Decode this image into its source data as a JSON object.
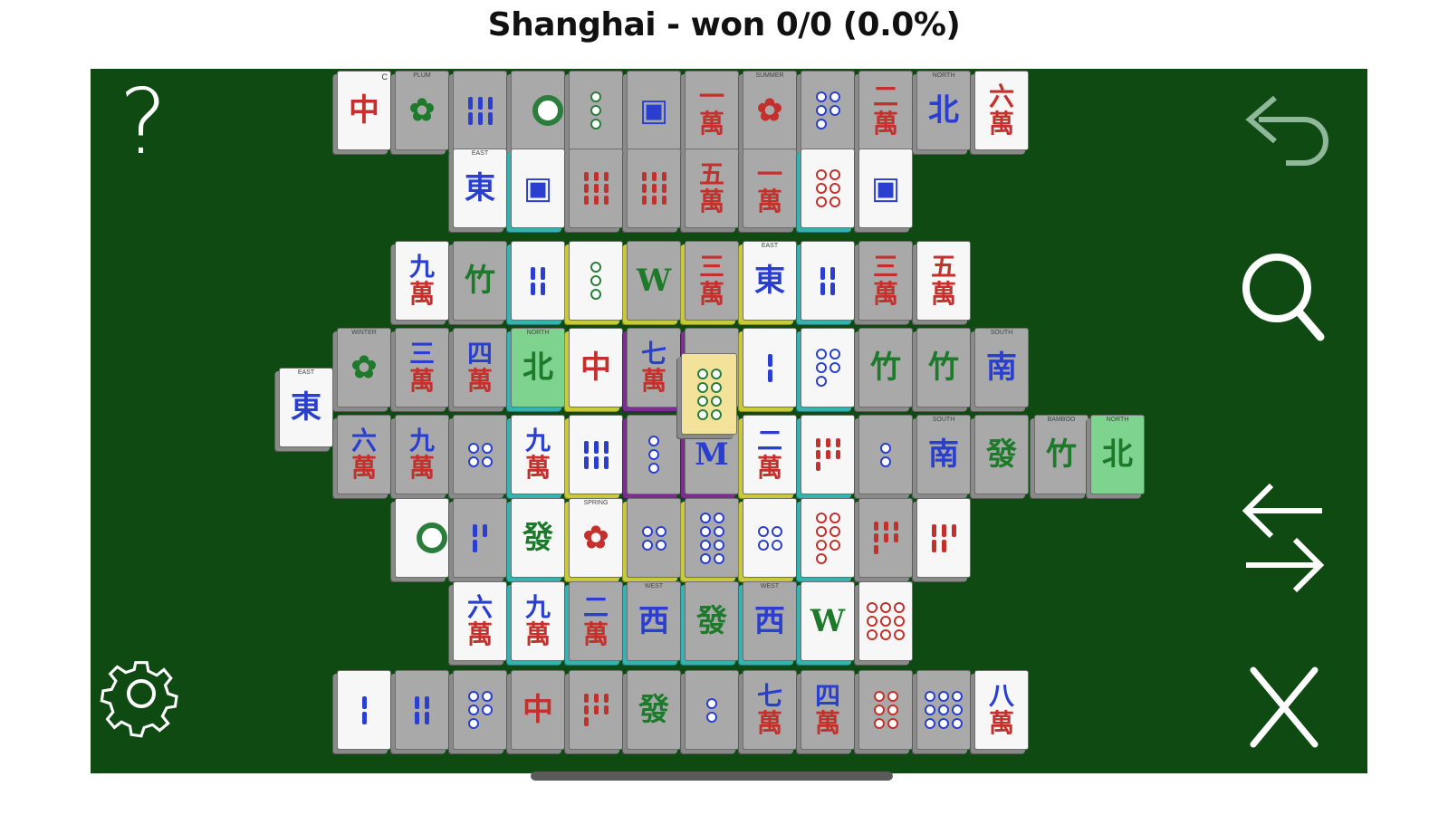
{
  "title": "Shanghai - won 0/0 (0.0%)",
  "controls": {
    "help": "?",
    "undo_icon": "undo-arrow-icon",
    "search_icon": "magnifier-icon",
    "shuffle_icon": "swap-arrows-icon",
    "settings_icon": "gear-icon",
    "close_icon": "close-x-icon"
  },
  "colors": {
    "felt": "#0f4a12",
    "tile_gray": "#a9a9a9",
    "tile_white": "#f7f7f7",
    "tile_green": "#7ed38f",
    "tile_yellow": "#f3e39a",
    "hl_teal": "#35b3b1",
    "hl_yellow": "#c9c93a",
    "hl_purple": "#7b2e8e"
  },
  "tiles": [
    {
      "id": "r0-0",
      "glyph": "中",
      "color": "red",
      "face": "white",
      "idx": "C"
    },
    {
      "id": "r0-1",
      "glyph": "✿",
      "color": "green",
      "face": "gray",
      "cap": "PLUM"
    },
    {
      "id": "r0-2",
      "glyph": "bam6",
      "color": "blue",
      "face": "gray"
    },
    {
      "id": "r0-3",
      "glyph": "dot1",
      "color": "green",
      "face": "gray"
    },
    {
      "id": "r0-4",
      "glyph": "dot3",
      "color": "green",
      "face": "gray"
    },
    {
      "id": "r0-5",
      "glyph": "▣",
      "color": "blue",
      "face": "gray"
    },
    {
      "id": "r0-6",
      "glyph": "一萬",
      "color": "red",
      "face": "gray"
    },
    {
      "id": "r0-7",
      "glyph": "✿",
      "color": "red",
      "face": "gray",
      "cap": "SUMMER"
    },
    {
      "id": "r0-8",
      "glyph": "dot5",
      "color": "blue",
      "face": "gray"
    },
    {
      "id": "r0-9",
      "glyph": "二萬",
      "color": "red",
      "face": "gray"
    },
    {
      "id": "r0-10",
      "glyph": "北",
      "color": "blue",
      "face": "gray",
      "cap": "NORTH"
    },
    {
      "id": "r0-11",
      "glyph": "六萬",
      "color": "red",
      "face": "white"
    },
    {
      "id": "r1-0",
      "glyph": "東",
      "color": "blue",
      "face": "white",
      "cap": "EAST"
    },
    {
      "id": "r1-1",
      "glyph": "▣",
      "color": "blue",
      "face": "white"
    },
    {
      "id": "r1-2",
      "glyph": "bam9",
      "color": "red",
      "face": "gray"
    },
    {
      "id": "r1-3",
      "glyph": "bam9",
      "color": "red",
      "face": "gray"
    },
    {
      "id": "r1-4",
      "glyph": "五萬",
      "color": "red",
      "face": "gray"
    },
    {
      "id": "r1-5",
      "glyph": "一萬",
      "color": "red",
      "face": "gray"
    },
    {
      "id": "r1-6",
      "glyph": "dot6",
      "color": "red",
      "face": "white"
    },
    {
      "id": "r1-7",
      "glyph": "▣",
      "color": "blue",
      "face": "white"
    },
    {
      "id": "r2-0",
      "glyph": "九萬",
      "color": "blue",
      "face": "white"
    },
    {
      "id": "r2-1",
      "glyph": "竹",
      "color": "green",
      "face": "gray"
    },
    {
      "id": "r2-2",
      "glyph": "bam4",
      "color": "blue",
      "face": "white"
    },
    {
      "id": "r2-3",
      "glyph": "dot3",
      "color": "green",
      "face": "white"
    },
    {
      "id": "r2-4",
      "glyph": "W",
      "color": "green",
      "face": "gray"
    },
    {
      "id": "r2-5",
      "glyph": "三萬",
      "color": "red",
      "face": "gray"
    },
    {
      "id": "r2-6",
      "glyph": "東",
      "color": "blue",
      "face": "white",
      "cap": "EAST"
    },
    {
      "id": "r2-7",
      "glyph": "bam4",
      "color": "blue",
      "face": "white"
    },
    {
      "id": "r2-8",
      "glyph": "三萬",
      "color": "red",
      "face": "gray"
    },
    {
      "id": "r2-9",
      "glyph": "五萬",
      "color": "red",
      "face": "white"
    },
    {
      "id": "r3-0",
      "glyph": "✿",
      "color": "green",
      "face": "gray",
      "cap": "WINTER"
    },
    {
      "id": "r3-1",
      "glyph": "三萬",
      "color": "blue",
      "face": "gray"
    },
    {
      "id": "r3-2",
      "glyph": "四萬",
      "color": "blue",
      "face": "gray"
    },
    {
      "id": "r3-3",
      "glyph": "北",
      "color": "green",
      "face": "green",
      "cap": "NORTH"
    },
    {
      "id": "r3-4",
      "glyph": "中",
      "color": "red",
      "face": "white"
    },
    {
      "id": "r3-5",
      "glyph": "七萬",
      "color": "blue",
      "face": "gray"
    },
    {
      "id": "r3-6",
      "glyph": "bam2",
      "color": "blue",
      "face": "gray"
    },
    {
      "id": "r3-7",
      "glyph": "bam2",
      "color": "blue",
      "face": "white"
    },
    {
      "id": "r3-8",
      "glyph": "dot5",
      "color": "blue",
      "face": "white"
    },
    {
      "id": "r3-9",
      "glyph": "竹",
      "color": "green",
      "face": "gray"
    },
    {
      "id": "r3-10",
      "glyph": "竹",
      "color": "green",
      "face": "gray"
    },
    {
      "id": "r3-11",
      "glyph": "南",
      "color": "blue",
      "face": "gray",
      "cap": "SOUTH"
    },
    {
      "id": "r4-0",
      "glyph": "東",
      "color": "blue",
      "face": "white",
      "cap": "EAST"
    },
    {
      "id": "r4-1",
      "glyph": "六萬",
      "color": "blue",
      "face": "gray"
    },
    {
      "id": "r4-2",
      "glyph": "九萬",
      "color": "blue",
      "face": "gray"
    },
    {
      "id": "r4-3",
      "glyph": "dot4",
      "color": "blue",
      "face": "gray"
    },
    {
      "id": "r4-4",
      "glyph": "九萬",
      "color": "blue",
      "face": "white"
    },
    {
      "id": "r4-5",
      "glyph": "bam6",
      "color": "blue",
      "face": "white"
    },
    {
      "id": "r4-6",
      "glyph": "dot3",
      "color": "blue",
      "face": "gray"
    },
    {
      "id": "r4-7",
      "glyph": "M",
      "color": "blue",
      "face": "gray"
    },
    {
      "id": "r4-8",
      "glyph": "二萬",
      "color": "blue",
      "face": "white"
    },
    {
      "id": "r4-9",
      "glyph": "bam7",
      "color": "red",
      "face": "white"
    },
    {
      "id": "r4-10",
      "glyph": "dot2",
      "color": "blue",
      "face": "gray"
    },
    {
      "id": "r4-11",
      "glyph": "南",
      "color": "blue",
      "face": "gray",
      "cap": "SOUTH"
    },
    {
      "id": "r4-12",
      "glyph": "發",
      "color": "green",
      "face": "gray"
    },
    {
      "id": "r4-13",
      "glyph": "竹",
      "color": "green",
      "face": "gray",
      "cap": "BAMBOO"
    },
    {
      "id": "r4-14",
      "glyph": "北",
      "color": "green",
      "face": "green",
      "cap": "NORTH"
    },
    {
      "id": "top",
      "glyph": "dot8",
      "color": "gray",
      "face": "yellow"
    },
    {
      "id": "r5-0",
      "glyph": "dot1",
      "color": "green",
      "face": "white"
    },
    {
      "id": "r5-1",
      "glyph": "bam3",
      "color": "blue",
      "face": "gray"
    },
    {
      "id": "r5-2",
      "glyph": "發",
      "color": "green",
      "face": "white"
    },
    {
      "id": "r5-3",
      "glyph": "✿",
      "color": "red",
      "face": "white",
      "cap": "SPRING"
    },
    {
      "id": "r5-4",
      "glyph": "dot4",
      "color": "blue",
      "face": "gray"
    },
    {
      "id": "r5-5",
      "glyph": "dot8",
      "color": "blue",
      "face": "gray"
    },
    {
      "id": "r5-6",
      "glyph": "dot4",
      "color": "blue",
      "face": "white"
    },
    {
      "id": "r5-7",
      "glyph": "dot7",
      "color": "red",
      "face": "white"
    },
    {
      "id": "r5-8",
      "glyph": "bam7",
      "color": "red",
      "face": "gray"
    },
    {
      "id": "r5-9",
      "glyph": "bam5",
      "color": "red",
      "face": "white"
    },
    {
      "id": "r6-0",
      "glyph": "六萬",
      "color": "blue",
      "face": "white"
    },
    {
      "id": "r6-1",
      "glyph": "九萬",
      "color": "blue",
      "face": "white"
    },
    {
      "id": "r6-2",
      "glyph": "二萬",
      "color": "blue",
      "face": "gray"
    },
    {
      "id": "r6-3",
      "glyph": "西",
      "color": "blue",
      "face": "gray",
      "cap": "WEST"
    },
    {
      "id": "r6-4",
      "glyph": "發",
      "color": "green",
      "face": "gray"
    },
    {
      "id": "r6-5",
      "glyph": "西",
      "color": "blue",
      "face": "gray",
      "cap": "WEST"
    },
    {
      "id": "r6-6",
      "glyph": "W",
      "color": "green",
      "face": "white"
    },
    {
      "id": "r6-7",
      "glyph": "dot9",
      "color": "red",
      "face": "white"
    },
    {
      "id": "r7-0",
      "glyph": "bam2",
      "color": "blue",
      "face": "white"
    },
    {
      "id": "r7-1",
      "glyph": "bam4",
      "color": "blue",
      "face": "gray"
    },
    {
      "id": "r7-2",
      "glyph": "dot5",
      "color": "blue",
      "face": "gray"
    },
    {
      "id": "r7-3",
      "glyph": "中",
      "color": "red",
      "face": "gray"
    },
    {
      "id": "r7-4",
      "glyph": "bam7",
      "color": "red",
      "face": "gray"
    },
    {
      "id": "r7-5",
      "glyph": "發",
      "color": "green",
      "face": "gray"
    },
    {
      "id": "r7-6",
      "glyph": "dot2",
      "color": "blue",
      "face": "gray"
    },
    {
      "id": "r7-7",
      "glyph": "七萬",
      "color": "blue",
      "face": "gray"
    },
    {
      "id": "r7-8",
      "glyph": "四萬",
      "color": "blue",
      "face": "gray"
    },
    {
      "id": "r7-9",
      "glyph": "dot6",
      "color": "red",
      "face": "gray"
    },
    {
      "id": "r7-10",
      "glyph": "dot9",
      "color": "blue",
      "face": "gray"
    },
    {
      "id": "r7-11",
      "glyph": "八萬",
      "color": "blue",
      "face": "white"
    }
  ]
}
